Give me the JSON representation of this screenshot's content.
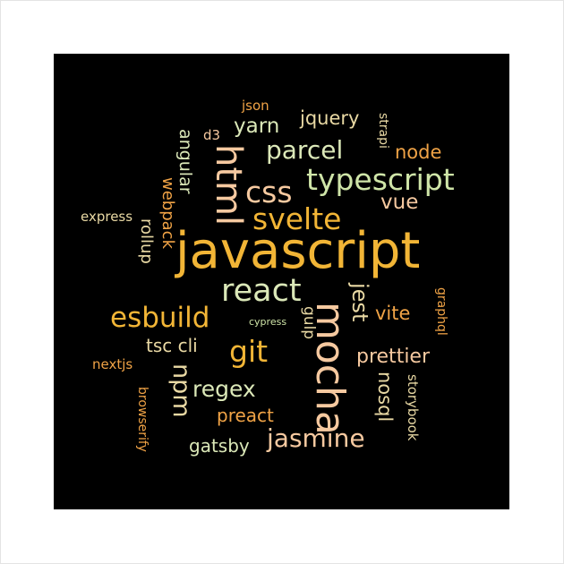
{
  "words": {
    "javascript": "javascript",
    "mocha": "mocha",
    "html": "html",
    "typescript": "typescript",
    "svelte": "svelte",
    "react": "react",
    "esbuild": "esbuild",
    "git": "git",
    "css": "css",
    "parcel": "parcel",
    "jasmine": "jasmine",
    "regex": "regex",
    "npm": "npm",
    "jest": "jest",
    "prettier": "prettier",
    "preact": "preact",
    "gatsby": "gatsby",
    "nosql": "nosql",
    "yarn": "yarn",
    "jquery": "jquery",
    "node": "node",
    "vue": "vue",
    "vite": "vite",
    "gulp": "gulp",
    "angular": "angular",
    "webpack": "webpack",
    "rollup": "rollup",
    "tsc_cli": "tsc cli",
    "express": "express",
    "nextjs": "nextjs",
    "browserify": "browserify",
    "storybook": "storybook",
    "graphql": "graphql",
    "strapi": "strapi",
    "json": "json",
    "d3": "d3",
    "cypress": "cypress"
  }
}
